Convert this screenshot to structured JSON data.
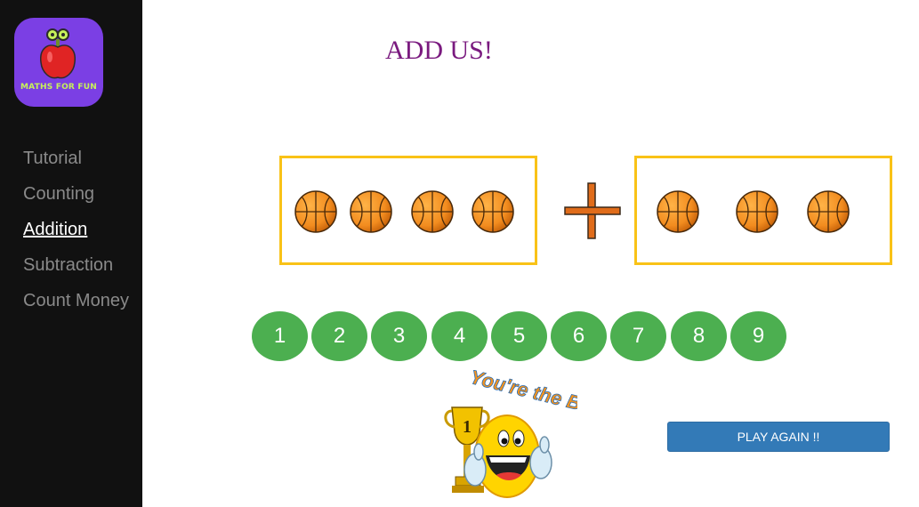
{
  "brand": {
    "logo_text": "MATHS FOR FUN"
  },
  "sidebar": {
    "items": [
      {
        "label": "Tutorial",
        "active": false
      },
      {
        "label": "Counting",
        "active": false
      },
      {
        "label": "Addition",
        "active": true
      },
      {
        "label": "Subtraction",
        "active": false
      },
      {
        "label": "Count Money",
        "active": false
      }
    ]
  },
  "main": {
    "title": "ADD US!",
    "left_group": {
      "count": 4,
      "icon": "basketball-icon"
    },
    "operator": {
      "icon": "plus-icon"
    },
    "right_group": {
      "count": 3,
      "icon": "basketball-icon"
    },
    "answer_options": [
      "1",
      "2",
      "3",
      "4",
      "5",
      "6",
      "7",
      "8",
      "9"
    ],
    "reward": {
      "text": "You're the Best!",
      "icon": "smiley-trophy-icon"
    },
    "play_again_label": "PLAY AGAIN !!"
  },
  "colors": {
    "sidebar_bg": "#111111",
    "logo_bg": "#7b3fe4",
    "title": "#7a1a7f",
    "box_border": "#f9c217",
    "answer_bg": "#4caf50",
    "play_button_bg": "#337ab7",
    "plus": "#e06c1a"
  }
}
